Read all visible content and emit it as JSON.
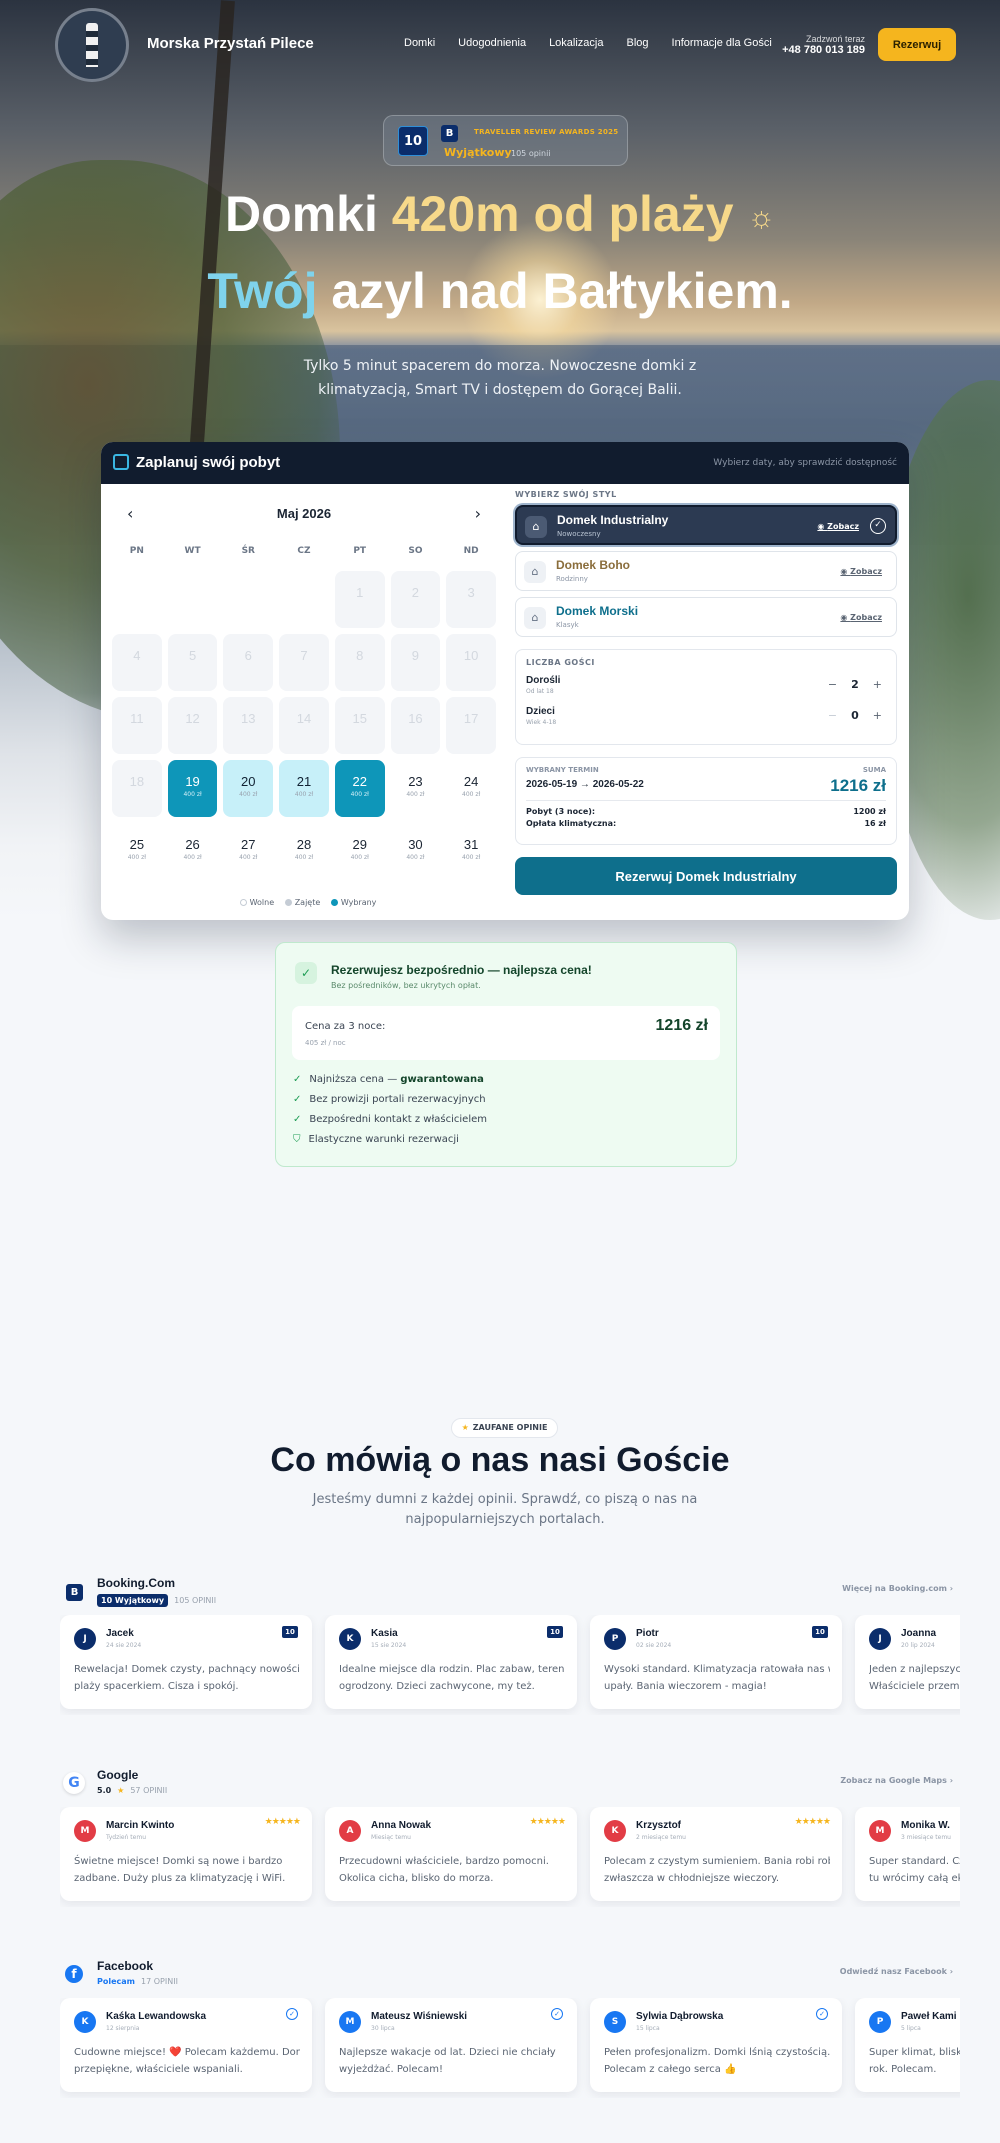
{
  "nav": {
    "brand": "Morska Przystań Pilece",
    "links": [
      "Domki",
      "Udogodnienia",
      "Lokalizacja",
      "Blog",
      "Informacje dla Gości"
    ],
    "call_label": "Zadzwoń teraz",
    "phone": "+48 780 013 189",
    "reserve": "Rezerwuj"
  },
  "award": {
    "score": "10",
    "b": "B",
    "title": "TRAVELLER REVIEW AWARDS 2025",
    "rating": "Wyjątkowy",
    "reviews": "105 opinii"
  },
  "hero": {
    "line1_a": "Domki ",
    "line1_b": "420m od plaży",
    "line1_icon": "☼",
    "line2_a": "Twój",
    "line2_b": " azyl nad Bałtykiem.",
    "sub": "Tylko 5 minut spacerem do morza. Nowoczesne domki z klimatyzacją, Smart TV i dostępem do Gorącej Balii."
  },
  "booking": {
    "title": "Zaplanuj swój pobyt",
    "hint": "Wybierz daty, aby sprawdzić dostępność",
    "calendar": {
      "month": "Maj 2026",
      "dow": [
        "PN",
        "WT",
        "ŚR",
        "CZ",
        "PT",
        "SO",
        "ND"
      ],
      "days": [
        {
          "d": "",
          "p": "",
          "s": "empty"
        },
        {
          "d": "",
          "p": "",
          "s": "empty"
        },
        {
          "d": "",
          "p": "",
          "s": "empty"
        },
        {
          "d": "",
          "p": "",
          "s": "empty"
        },
        {
          "d": "1",
          "p": "",
          "s": "past"
        },
        {
          "d": "2",
          "p": "",
          "s": "past"
        },
        {
          "d": "3",
          "p": "",
          "s": "past"
        },
        {
          "d": "4",
          "p": "",
          "s": "past"
        },
        {
          "d": "5",
          "p": "",
          "s": "past"
        },
        {
          "d": "6",
          "p": "",
          "s": "past"
        },
        {
          "d": "7",
          "p": "",
          "s": "past"
        },
        {
          "d": "8",
          "p": "",
          "s": "past"
        },
        {
          "d": "9",
          "p": "",
          "s": "past"
        },
        {
          "d": "10",
          "p": "",
          "s": "past"
        },
        {
          "d": "11",
          "p": "",
          "s": "past"
        },
        {
          "d": "12",
          "p": "",
          "s": "past"
        },
        {
          "d": "13",
          "p": "",
          "s": "past"
        },
        {
          "d": "14",
          "p": "",
          "s": "past"
        },
        {
          "d": "15",
          "p": "",
          "s": "past"
        },
        {
          "d": "16",
          "p": "",
          "s": "past"
        },
        {
          "d": "17",
          "p": "",
          "s": "past"
        },
        {
          "d": "18",
          "p": "",
          "s": "past"
        },
        {
          "d": "19",
          "p": "400 zł",
          "s": "sel"
        },
        {
          "d": "20",
          "p": "400 zł",
          "s": "range"
        },
        {
          "d": "21",
          "p": "400 zł",
          "s": "range"
        },
        {
          "d": "22",
          "p": "400 zł",
          "s": "sel"
        },
        {
          "d": "23",
          "p": "400 zł",
          "s": "free"
        },
        {
          "d": "24",
          "p": "400 zł",
          "s": "free"
        },
        {
          "d": "25",
          "p": "400 zł",
          "s": "free"
        },
        {
          "d": "26",
          "p": "400 zł",
          "s": "free"
        },
        {
          "d": "27",
          "p": "400 zł",
          "s": "free"
        },
        {
          "d": "28",
          "p": "400 zł",
          "s": "free"
        },
        {
          "d": "29",
          "p": "400 zł",
          "s": "free"
        },
        {
          "d": "30",
          "p": "400 zł",
          "s": "free"
        },
        {
          "d": "31",
          "p": "400 zł",
          "s": "free"
        }
      ],
      "legend": [
        "Wolne",
        "Zajęte",
        "Wybrany"
      ]
    },
    "style_label": "WYBIERZ SWÓJ STYL",
    "styles": [
      {
        "name": "Domek Industrialny",
        "sub": "Nowoczesny",
        "see": "Zobacz",
        "color": "#ffffff"
      },
      {
        "name": "Domek Boho",
        "sub": "Rodzinny",
        "see": "Zobacz",
        "color": "#8a6d3b"
      },
      {
        "name": "Domek Morski",
        "sub": "Klasyk",
        "see": "Zobacz",
        "color": "#0e6f8c"
      }
    ],
    "guests_label": "LICZBA GOŚCI",
    "adults": {
      "name": "Dorośli",
      "sub": "Od lat 18",
      "value": "2"
    },
    "kids": {
      "name": "Dzieci",
      "sub": "Wiek 4-18",
      "value": "0"
    },
    "summary": {
      "label": "WYBRANY TERMIN",
      "dates": "2026-05-19 → 2026-05-22",
      "total_label": "SUMA",
      "total": "1216 zł",
      "stay_label": "Pobyt (3 noce):",
      "stay_value": "1200 zł",
      "fee_label": "Opłata klimatyczna:",
      "fee_value": "16 zł"
    },
    "cta": "Rezerwuj Domek Industrialny"
  },
  "best": {
    "title": "Rezerwujesz bezpośrednio — najlepsza cena!",
    "sub": "Bez pośredników, bez ukrytych opłat.",
    "price_label": "Cena za 3 noce:",
    "price_sub": "405 zł / noc",
    "price": "1216 zł",
    "items": [
      {
        "pre": "Najniższa cena — ",
        "bold": "gwarantowana"
      },
      {
        "pre": "Bez prowizji portali rezerwacyjnych",
        "bold": ""
      },
      {
        "pre": "Bezpośredni kontakt z właścicielem",
        "bold": ""
      },
      {
        "pre": "Elastyczne warunki rezerwacji",
        "bold": ""
      }
    ]
  },
  "reviews": {
    "pill": "ZAUFANE OPINIE",
    "title": "Co mówią o nas nasi Goście",
    "sub": "Jesteśmy dumni z każdej opinii. Sprawdź, co piszą o nas na najpopularniejszych portalach.",
    "sources": [
      {
        "name": "Booking.Com",
        "tag": "10 Wyjątkowy",
        "count": "105 OPINII",
        "more": "Więcej na Booking.com ›",
        "cards": [
          {
            "init": "J",
            "name": "Jacek",
            "date": "24 sie 2024",
            "text1": "Rewelacja! Domek czysty, pachnący nowością. Do",
            "text2": "plaży spacerkiem. Cisza i spokój."
          },
          {
            "init": "K",
            "name": "Kasia",
            "date": "15 sie 2024",
            "text1": "Idealne miejsce dla rodzin. Plac zabaw, teren",
            "text2": "ogrodzony. Dzieci zachwycone, my też."
          },
          {
            "init": "P",
            "name": "Piotr",
            "date": "02 sie 2024",
            "text1": "Wysoki standard. Klimatyzacja ratowała nas w",
            "text2": "upały. Bania wieczorem - magia!"
          },
          {
            "init": "J",
            "name": "Joanna",
            "date": "20 lip 2024",
            "text1": "Jeden z najlepszych",
            "text2": "Właściciele przemili"
          }
        ]
      },
      {
        "name": "Google",
        "score": "5.0",
        "stars": "★",
        "count": "57 OPINII",
        "more": "Zobacz na Google Maps ›",
        "cards": [
          {
            "init": "M",
            "name": "Marcin Kwinto",
            "date": "Tydzień temu",
            "text1": "Świetne miejsce! Domki są nowe i bardzo",
            "text2": "zadbane. Duży plus za klimatyzację i WiFi."
          },
          {
            "init": "A",
            "name": "Anna Nowak",
            "date": "Miesiąc temu",
            "text1": "Przecudowni właściciele, bardzo pomocni.",
            "text2": "Okolica cicha, blisko do morza."
          },
          {
            "init": "K",
            "name": "Krzysztof",
            "date": "2 miesiące temu",
            "text1": "Polecam z czystym sumieniem. Bania robi robotę,",
            "text2": "zwłaszcza w chłodniejsze wieczory."
          },
          {
            "init": "M",
            "name": "Monika W.",
            "date": "3 miesiące temu",
            "text1": "Super standard. Czy",
            "text2": "tu wrócimy całą ekip"
          }
        ]
      },
      {
        "name": "Facebook",
        "tag": "Polecam",
        "count": "17 OPINII",
        "more": "Odwiedź nasz Facebook ›",
        "cards": [
          {
            "init": "K",
            "name": "Kaśka Lewandowska",
            "date": "12 sierpnia",
            "text1": "Cudowne miejsce! ❤️ Polecam każdemu. Domki",
            "text2": "przepiękne, właściciele wspaniali."
          },
          {
            "init": "M",
            "name": "Mateusz Wiśniewski",
            "date": "30 lipca",
            "text1": "Najlepsze wakacje od lat. Dzieci nie chciały",
            "text2": "wyjeżdżać. Polecam!"
          },
          {
            "init": "S",
            "name": "Sylwia Dąbrowska",
            "date": "15 lipca",
            "text1": "Pełen profesjonalizm. Domki lśnią czystością.",
            "text2": "Polecam z całego serca 👍"
          },
          {
            "init": "P",
            "name": "Paweł Kami",
            "date": "5 lipca",
            "text1": "Super klimat, blisko",
            "text2": "rok. Polecam."
          }
        ]
      }
    ]
  },
  "colors": {
    "accent": "#0e6f8c",
    "gold": "#f5b51e",
    "booking": "#0b2d6b",
    "facebook": "#1877f2"
  }
}
